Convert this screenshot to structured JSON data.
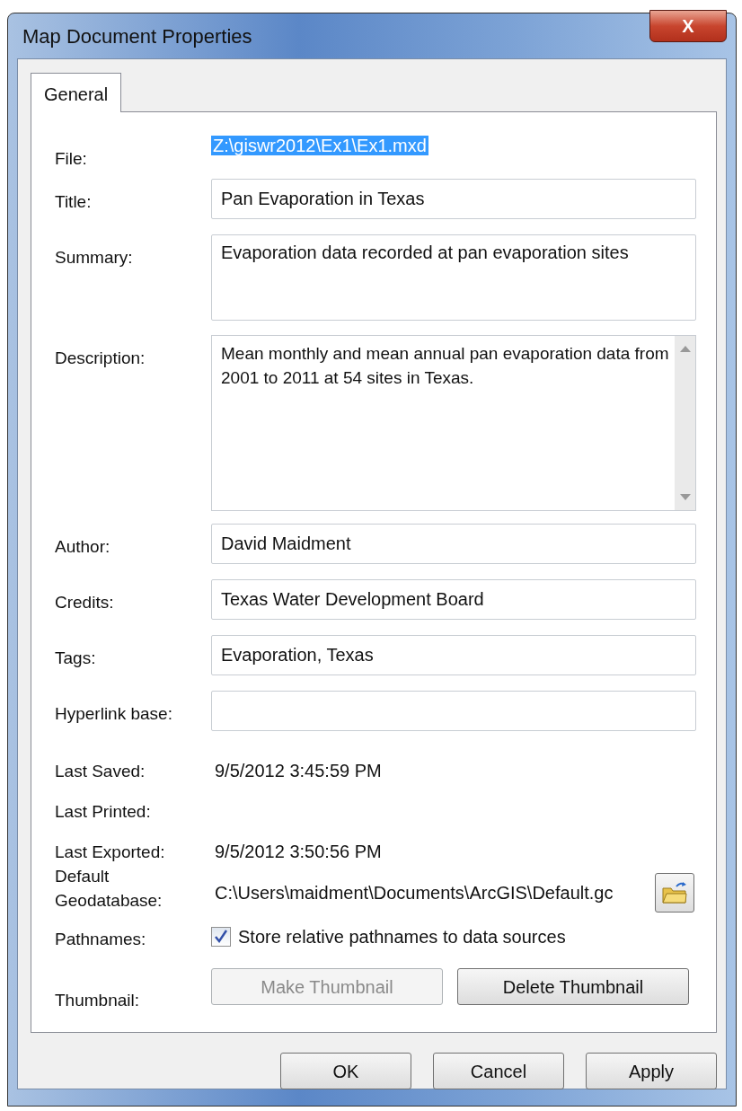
{
  "window": {
    "title": "Map Document Properties",
    "close": "X"
  },
  "tabs": [
    {
      "label": "General",
      "selected": true
    }
  ],
  "fields": [
    {
      "kind": "selected_text",
      "label": "File:",
      "value": "Z:\\giswr2012\\Ex1\\Ex1.mxd"
    },
    {
      "kind": "input",
      "label": "Title:",
      "value": "Pan Evaporation in Texas"
    },
    {
      "kind": "multiline",
      "label": "Summary:",
      "value": "Evaporation data recorded at pan evaporation sites"
    },
    {
      "kind": "scroll_multiline",
      "label": "Description:",
      "value": "Mean monthly and mean annual pan evaporation data from 2001 to 2011 at 54 sites in Texas."
    },
    {
      "kind": "input",
      "label": "Author:",
      "value": "David Maidment"
    },
    {
      "kind": "input",
      "label": "Credits:",
      "value": "Texas Water Development Board"
    },
    {
      "kind": "input",
      "label": "Tags:",
      "value": "Evaporation, Texas"
    },
    {
      "kind": "input",
      "label": "Hyperlink base:"
    },
    {
      "kind": "text",
      "label": "Last Saved:",
      "value": "9/5/2012 3:45:59 PM"
    },
    {
      "kind": "text",
      "label": "Last Printed:"
    },
    {
      "kind": "text",
      "label": "Last Exported:",
      "value": "9/5/2012 3:50:56 PM"
    },
    {
      "kind": "path",
      "label": "Default Geodatabase:",
      "value": "C:\\Users\\maidment\\Documents\\ArcGIS\\Default.gc"
    },
    {
      "kind": "checkbox",
      "label": "Pathnames:",
      "value": "Store relative pathnames to data sources",
      "checked": true
    },
    {
      "kind": "buttons",
      "label": "Thumbnail:",
      "buttons": [
        {
          "label": "Make Thumbnail",
          "disabled": true
        },
        {
          "label": "Delete Thumbnail",
          "disabled": false
        }
      ]
    }
  ],
  "buttons": [
    {
      "label": "OK"
    },
    {
      "label": "Cancel"
    },
    {
      "label": "Apply"
    }
  ]
}
